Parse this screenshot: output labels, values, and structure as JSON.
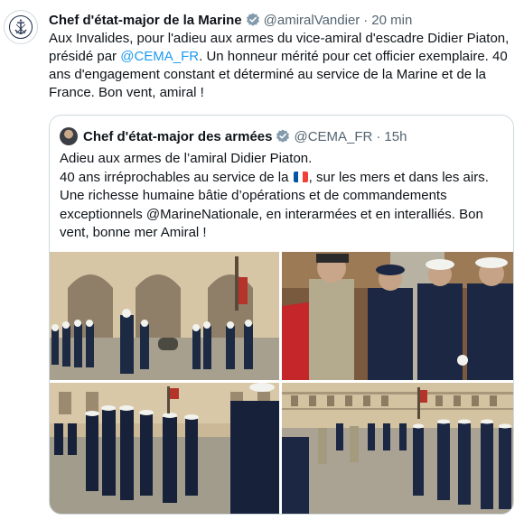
{
  "tweet": {
    "author_name": "Chef d'état-major de la Marine",
    "handle": "@amiralVandier",
    "separator": "·",
    "time": "20 min",
    "text_before_link": "Aux Invalides, pour l'adieu aux armes du vice-amiral d'escadre Didier Piaton, présidé par ",
    "link": "@CEMA_FR",
    "text_after_link": ". Un honneur mérité pour cet officier exemplaire. 40 ans d'engagement constant et déterminé au service de la Marine et de la France. Bon vent, amiral !"
  },
  "quote": {
    "author_name": "Chef d'état-major des armées",
    "handle": "@CEMA_FR",
    "separator": "·",
    "time": "15h",
    "line1": "Adieu aux armes de l’amiral Didier Piaton.",
    "line2_before_flag": "40 ans irréprochables au service de la ",
    "line2_after_flag": ", sur les mers et dans les airs.",
    "line3": "Une richesse humaine bâtie d’opérations et de commandements exceptionnels @MarineNationale, en interarmées et en interalliés. Bon vent, bonne mer Amiral !"
  },
  "colors": {
    "link": "#1d9bf0",
    "verified": "#829aab",
    "text": "#0f1419",
    "secondary": "#536471"
  },
  "icons": {
    "avatar": "naval-anchor-emblem-icon",
    "verified": "verified-badge-icon",
    "flag": "france-flag-icon"
  }
}
